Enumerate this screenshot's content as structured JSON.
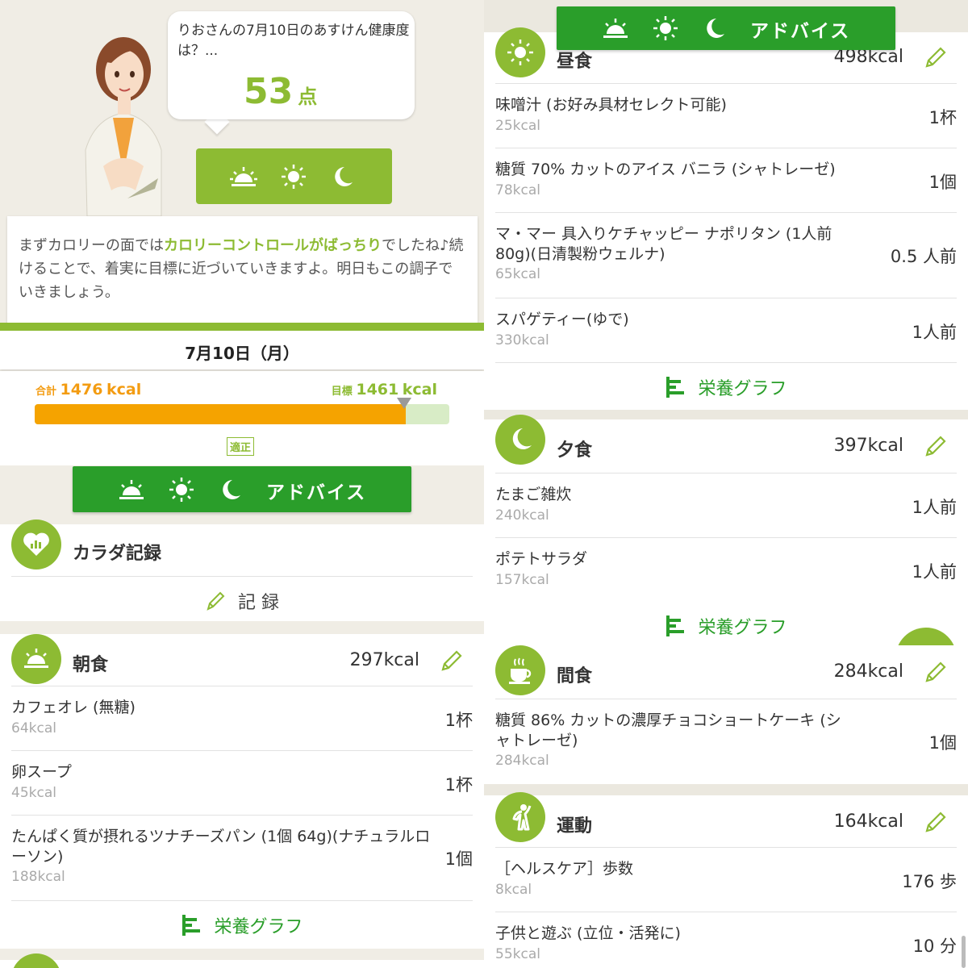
{
  "coach": {
    "greeting": "りおさんの7月10日のあすけん健康度は？...",
    "score": "53",
    "score_unit": "点"
  },
  "advice": {
    "pre": "まずカロリーの面では",
    "highlight": "カロリーコントロールがばっちり",
    "post": "でしたね♪続けることで、着実に目標に近づいていきますよ。明日もこの調子でいきましょう。"
  },
  "date": "7月10日（月）",
  "calories": {
    "total_label": "合計",
    "total_value": "1476",
    "goal_label": "目標",
    "goal_value": "1461",
    "unit": "kcal",
    "status": "適正",
    "total_num": 1476,
    "goal_num": 1461
  },
  "advice_button": {
    "label": "アドバイス"
  },
  "body_record": {
    "title": "カラダ記録",
    "action": "記 録"
  },
  "graph_label": "栄養グラフ",
  "meals": {
    "breakfast": {
      "title": "朝食",
      "kcal": "297kcal",
      "items": [
        {
          "name": "カフェオレ (無糖)",
          "kcal": "64kcal",
          "qty": "1杯"
        },
        {
          "name": "卵スープ",
          "kcal": "45kcal",
          "qty": "1杯"
        },
        {
          "name": "たんぱく質が摂れるツナチーズパン (1個 64g)(ナチュラルローソン)",
          "kcal": "188kcal",
          "qty": "1個"
        }
      ]
    },
    "lunch": {
      "title": "昼食",
      "kcal": "498kcal",
      "items": [
        {
          "name": "味噌汁 (お好み具材セレクト可能)",
          "kcal": "25kcal",
          "qty": "1杯"
        },
        {
          "name": "糖質 70% カットのアイス バニラ (シャトレーゼ)",
          "kcal": "78kcal",
          "qty": "1個"
        },
        {
          "name": "マ・マー 具入りケチャッピー ナポリタン (1人前 80g)(日清製粉ウェルナ)",
          "kcal": "65kcal",
          "qty": "0.5 人前"
        },
        {
          "name": "スパゲティー(ゆで)",
          "kcal": "330kcal",
          "qty": "1人前"
        }
      ]
    },
    "dinner": {
      "title": "夕食",
      "kcal": "397kcal",
      "items": [
        {
          "name": "たまご雑炊",
          "kcal": "240kcal",
          "qty": "1人前"
        },
        {
          "name": "ポテトサラダ",
          "kcal": "157kcal",
          "qty": "1人前"
        }
      ]
    },
    "snack": {
      "title": "間食",
      "kcal": "284kcal",
      "items": [
        {
          "name": "糖質 86% カットの濃厚チョコショートケーキ (シャトレーゼ)",
          "kcal": "284kcal",
          "qty": "1個"
        }
      ]
    },
    "exercise": {
      "title": "運動",
      "kcal": "164kcal",
      "items": [
        {
          "name": "［ヘルスケア］歩数",
          "kcal": "8kcal",
          "qty": "176 歩"
        },
        {
          "name": "子供と遊ぶ (立位・活発に)",
          "kcal": "55kcal",
          "qty": "10 分"
        }
      ]
    }
  },
  "colors": {
    "accent_green": "#8dbb33",
    "button_green": "#2a9e2a",
    "orange": "#f5a300"
  }
}
